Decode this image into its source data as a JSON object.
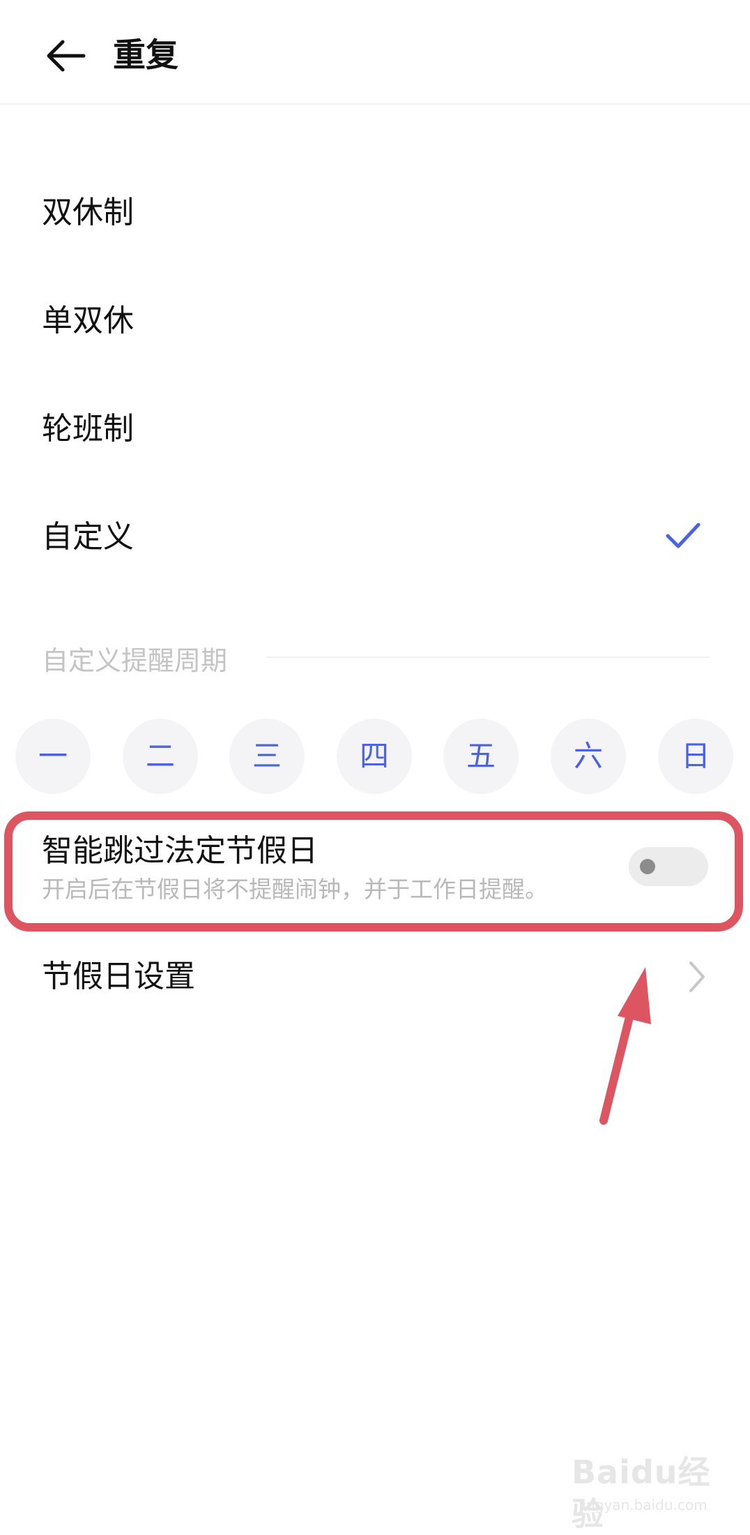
{
  "header": {
    "title": "重复"
  },
  "options": [
    {
      "label": "双休制",
      "selected": false
    },
    {
      "label": "单双休",
      "selected": false
    },
    {
      "label": "轮班制",
      "selected": false
    },
    {
      "label": "自定义",
      "selected": true
    }
  ],
  "custom_section": {
    "label": "自定义提醒周期",
    "days": [
      "一",
      "二",
      "三",
      "四",
      "五",
      "六",
      "日"
    ]
  },
  "smart_skip": {
    "title": "智能跳过法定节假日",
    "subtitle": "开启后在节假日将不提醒闹钟，并于工作日提醒。",
    "enabled": false
  },
  "holiday_settings": {
    "label": "节假日设置"
  },
  "watermark": {
    "brand": "Baidu经验",
    "url": "jingyan.baidu.com"
  },
  "colors": {
    "accent": "#4c62e5",
    "annotation": "#dd5561"
  }
}
